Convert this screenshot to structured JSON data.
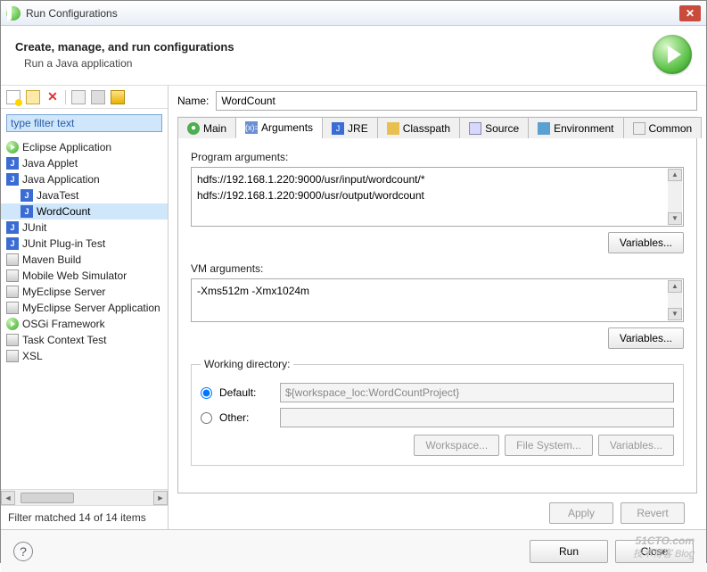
{
  "window": {
    "title": "Run Configurations"
  },
  "header": {
    "title": "Create, manage, and run configurations",
    "subtitle": "Run a Java application"
  },
  "sidebar": {
    "filter_placeholder": "type filter text",
    "items": [
      {
        "label": "Eclipse Application",
        "icon": "run"
      },
      {
        "label": "Java Applet",
        "icon": "j"
      },
      {
        "label": "Java Application",
        "icon": "j"
      },
      {
        "label": "JavaTest",
        "icon": "j",
        "child": true
      },
      {
        "label": "WordCount",
        "icon": "j",
        "child": true,
        "selected": true
      },
      {
        "label": "JUnit",
        "icon": "j"
      },
      {
        "label": "JUnit Plug-in Test",
        "icon": "j"
      },
      {
        "label": "Maven Build",
        "icon": "app"
      },
      {
        "label": "Mobile Web Simulator",
        "icon": "app"
      },
      {
        "label": "MyEclipse Server",
        "icon": "app"
      },
      {
        "label": "MyEclipse Server Application",
        "icon": "app"
      },
      {
        "label": "OSGi Framework",
        "icon": "run"
      },
      {
        "label": "Task Context Test",
        "icon": "app"
      },
      {
        "label": "XSL",
        "icon": "app"
      }
    ],
    "status": "Filter matched 14 of 14 items"
  },
  "main": {
    "name_label": "Name:",
    "name_value": "WordCount",
    "tabs": [
      {
        "label": "Main",
        "icon": "main"
      },
      {
        "label": "Arguments",
        "icon": "args",
        "active": true
      },
      {
        "label": "JRE",
        "icon": "jre"
      },
      {
        "label": "Classpath",
        "icon": "cp"
      },
      {
        "label": "Source",
        "icon": "src"
      },
      {
        "label": "Environment",
        "icon": "env"
      },
      {
        "label": "Common",
        "icon": "common"
      }
    ],
    "program_args_label": "Program arguments:",
    "program_args_value": "hdfs://192.168.1.220:9000/usr/input/wordcount/*\nhdfs://192.168.1.220:9000/usr/output/wordcount",
    "vm_args_label": "VM arguments:",
    "vm_args_value": "-Xms512m -Xmx1024m",
    "variables_label": "Variables...",
    "working_dir": {
      "legend": "Working directory:",
      "default_label": "Default:",
      "default_value": "${workspace_loc:WordCountProject}",
      "other_label": "Other:",
      "workspace_btn": "Workspace...",
      "filesystem_btn": "File System...",
      "variables_btn": "Variables..."
    },
    "apply_label": "Apply",
    "revert_label": "Revert"
  },
  "footer": {
    "run_label": "Run",
    "close_label": "Close"
  },
  "watermark": {
    "line1": "51CTO.com",
    "line2": "技术博客 Blog"
  }
}
